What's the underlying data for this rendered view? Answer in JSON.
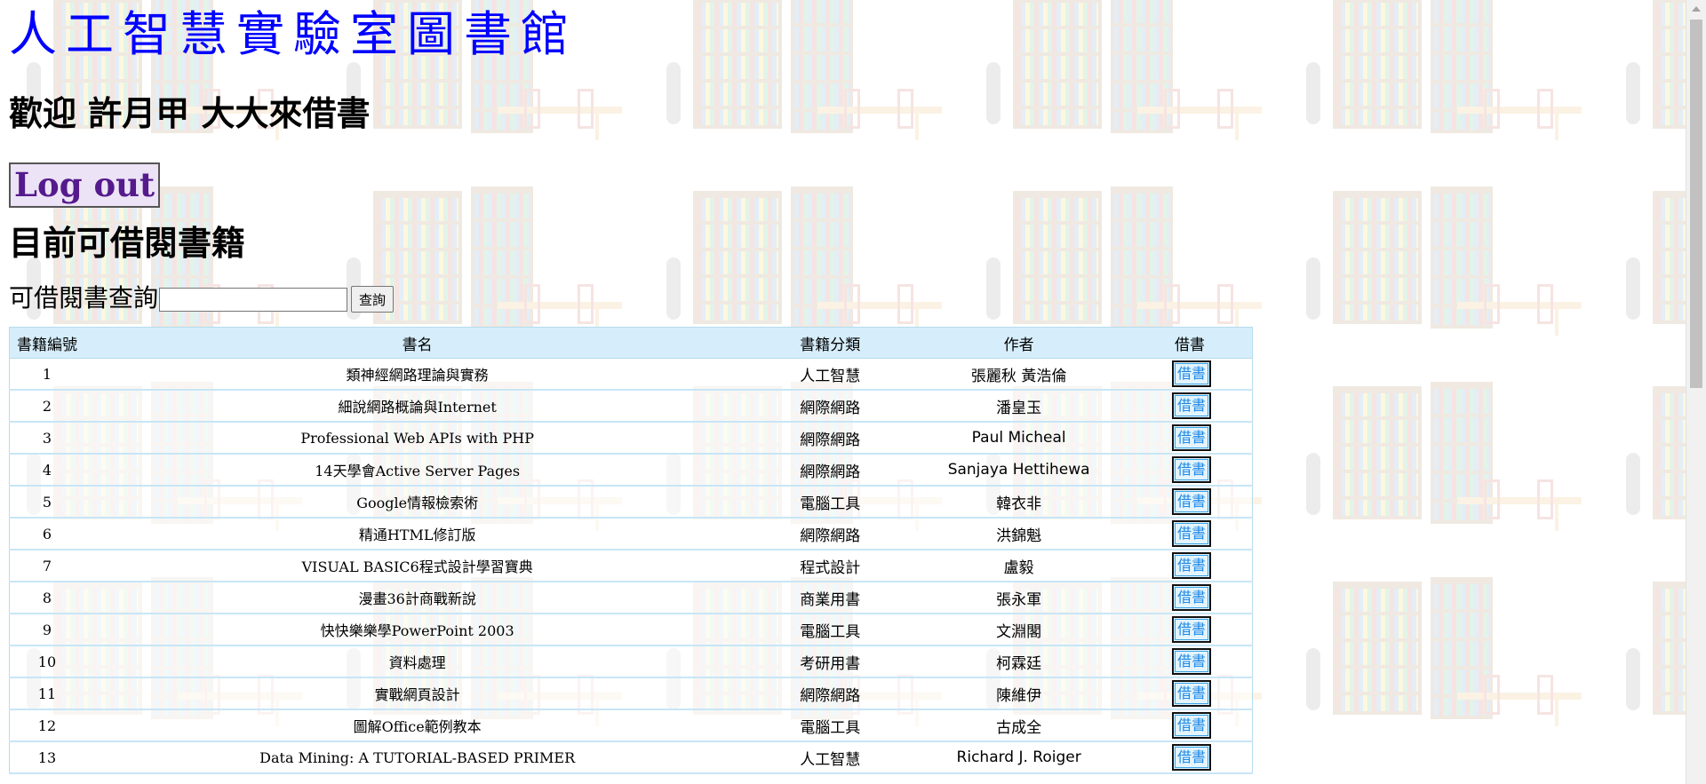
{
  "header": {
    "site_title": "人工智慧實驗室圖書館",
    "welcome": "歡迎 許月甲 大大來借書",
    "logout_label": "Log out"
  },
  "section": {
    "title": "目前可借閱書籍"
  },
  "search": {
    "label": "可借閱書查詢",
    "value": "",
    "button_label": "查詢"
  },
  "table": {
    "headers": [
      "書籍編號",
      "書名",
      "書籍分類",
      "作者",
      "借書"
    ],
    "rows": [
      {
        "id": "1",
        "title": "類神經網路理論與實務",
        "category": "人工智慧",
        "author": "張麗秋 黃浩倫",
        "action": "借書"
      },
      {
        "id": "2",
        "title": "細說網路概論與Internet",
        "category": "網際網路",
        "author": "潘皇玉",
        "action": "借書"
      },
      {
        "id": "3",
        "title": "Professional Web APIs with PHP",
        "category": "網際網路",
        "author": "Paul Micheal",
        "action": "借書"
      },
      {
        "id": "4",
        "title": "14天學會Active Server Pages",
        "category": "網際網路",
        "author": "Sanjaya Hettihewa",
        "action": "借書"
      },
      {
        "id": "5",
        "title": "Google情報檢索術",
        "category": "電腦工具",
        "author": "韓衣非",
        "action": "借書"
      },
      {
        "id": "6",
        "title": "精通HTML修訂版",
        "category": "網際網路",
        "author": "洪錦魁",
        "action": "借書"
      },
      {
        "id": "7",
        "title": "VISUAL BASIC6程式設計學習寶典",
        "category": "程式設計",
        "author": "盧毅",
        "action": "借書"
      },
      {
        "id": "8",
        "title": "漫畫36計商戰新說",
        "category": "商業用書",
        "author": "張永軍",
        "action": "借書"
      },
      {
        "id": "9",
        "title": "快快樂樂學PowerPoint 2003",
        "category": "電腦工具",
        "author": "文淵閣",
        "action": "借書"
      },
      {
        "id": "10",
        "title": "資料處理",
        "category": "考研用書",
        "author": "柯霖廷",
        "action": "借書"
      },
      {
        "id": "11",
        "title": "實戰網頁設計",
        "category": "網際網路",
        "author": "陳維伊",
        "action": "借書"
      },
      {
        "id": "12",
        "title": "圖解Office範例教本",
        "category": "電腦工具",
        "author": "古成全",
        "action": "借書"
      },
      {
        "id": "13",
        "title": "Data Mining: A TUTORIAL-BASED PRIMER",
        "category": "人工智慧",
        "author": "Richard J. Roiger",
        "action": "借書"
      }
    ]
  }
}
